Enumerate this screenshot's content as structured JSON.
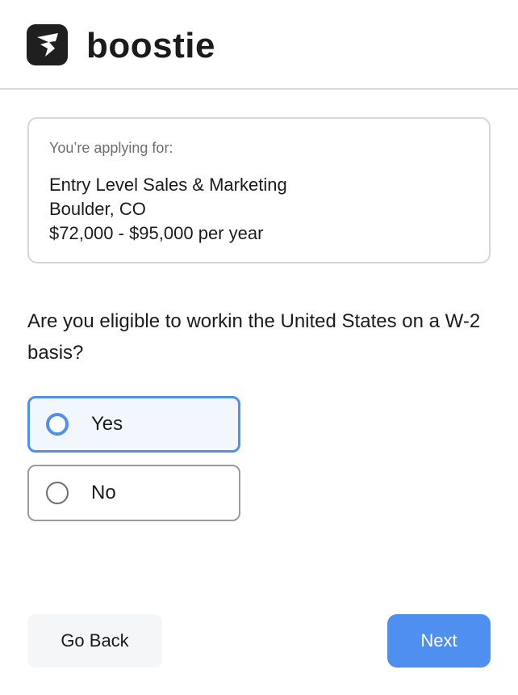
{
  "brand": {
    "name": "boostie",
    "logo_icon": "boostie-logo-icon"
  },
  "job": {
    "label": "You’re applying for:",
    "title": "Entry Level Sales & Marketing",
    "location": "Boulder, CO",
    "salary": "$72,000 - $95,000 per year"
  },
  "question": {
    "text": "Are you eligible to workin the United States on a W-2 basis?",
    "options": [
      {
        "label": "Yes",
        "selected": true
      },
      {
        "label": "No",
        "selected": false
      }
    ]
  },
  "actions": {
    "back_label": "Go Back",
    "next_label": "Next"
  },
  "colors": {
    "accent": "#4f8ff0",
    "selected_bg": "#f2f7fe",
    "logo_bg": "#1f1f1f"
  }
}
